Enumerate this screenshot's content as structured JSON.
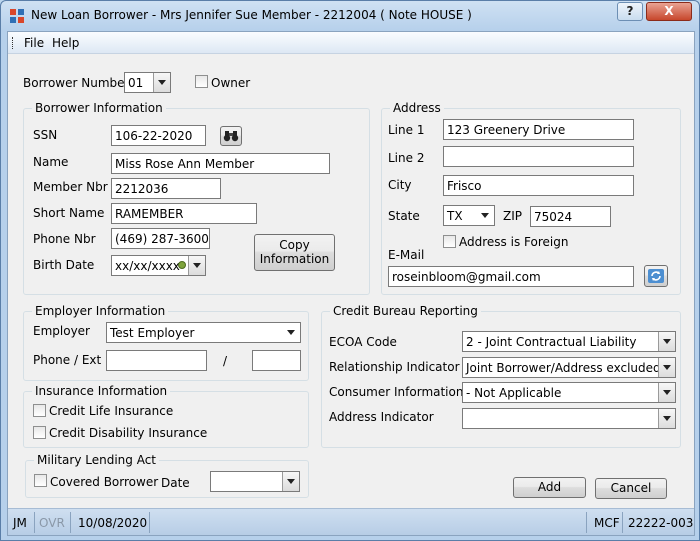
{
  "window": {
    "title": "New Loan Borrower - Mrs Jennifer Sue Member - 2212004 ( Note  HOUSE )",
    "help_label": "?",
    "close_label": "X"
  },
  "menu": {
    "file": "File",
    "help": "Help"
  },
  "borrower": {
    "number_label": "Borrower Number",
    "number_value": "01",
    "owner_label": "Owner"
  },
  "borrower_info": {
    "title": "Borrower Information",
    "ssn_label": "SSN",
    "ssn": "106-22-2020",
    "name_label": "Name",
    "name": "Miss Rose Ann Member",
    "member_nbr_label": "Member Nbr",
    "member_nbr": "2212036",
    "short_name_label": "Short Name",
    "short_name": "RAMEMBER",
    "phone_label": "Phone Nbr",
    "phone": "(469) 287-3600",
    "birth_label": "Birth Date",
    "birth": "xx/xx/xxxx",
    "copy_button": "Copy Information"
  },
  "address": {
    "title": "Address",
    "line1_label": "Line 1",
    "line1": "123 Greenery Drive",
    "line2_label": "Line 2",
    "line2": "",
    "city_label": "City",
    "city": "Frisco",
    "state_label": "State",
    "state": "TX",
    "zip_label": "ZIP",
    "zip": "75024",
    "foreign_label": "Address is Foreign",
    "email_label": "E-Mail",
    "email": "roseinbloom@gmail.com"
  },
  "employer": {
    "title": "Employer Information",
    "employer_label": "Employer",
    "employer": "Test Employer",
    "phone_label": "Phone / Ext",
    "slash": "/"
  },
  "insurance": {
    "title": "Insurance Information",
    "life": "Credit Life Insurance",
    "disability": "Credit Disability Insurance"
  },
  "military": {
    "title": "Military Lending Act",
    "covered": "Covered Borrower",
    "date_label": "Date"
  },
  "credit": {
    "title": "Credit Bureau Reporting",
    "ecoa_label": "ECOA Code",
    "ecoa": "2 - Joint Contractual Liability",
    "relationship_label": "Relationship Indicator",
    "relationship": "Joint Borrower/Address excluded",
    "consumer_label": "Consumer Information",
    "consumer": "- Not Applicable",
    "address_ind_label": "Address Indicator",
    "address_ind": ""
  },
  "actions": {
    "add": "Add",
    "cancel": "Cancel"
  },
  "status": {
    "user": "JM",
    "ovr": "OVR",
    "date": "10/08/2020",
    "mcf": "MCF",
    "code": "22222-003"
  }
}
